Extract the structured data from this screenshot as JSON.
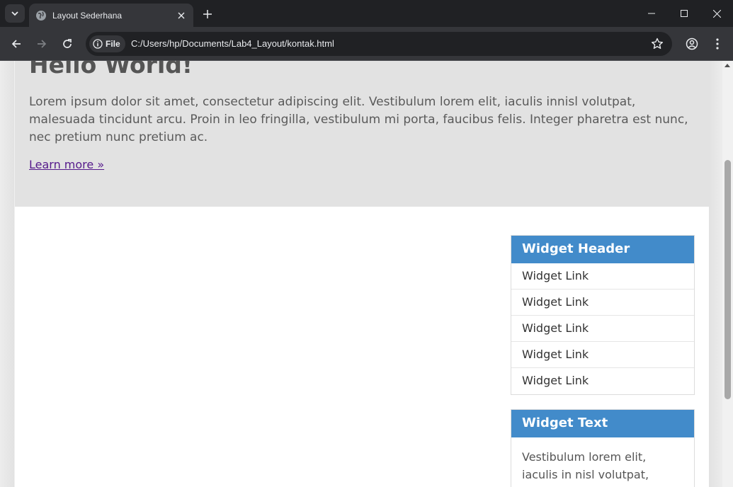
{
  "browser": {
    "tab_title": "Layout Sederhana",
    "chip_label": "File",
    "url": "C:/Users/hp/Documents/Lab4_Layout/kontak.html"
  },
  "hero": {
    "heading": "Hello World!",
    "paragraph": "Lorem ipsum dolor sit amet, consectetur adipiscing elit. Vestibulum lorem elit, iaculis innisl volutpat, malesuada tincidunt arcu. Proin in leo fringilla, vestibulum mi porta, faucibus felis. Integer pharetra est nunc, nec pretium nunc pretium ac.",
    "link": "Learn more »"
  },
  "sidebar": {
    "links_widget": {
      "header": "Widget Header",
      "links": [
        "Widget Link",
        "Widget Link",
        "Widget Link",
        "Widget Link",
        "Widget Link"
      ]
    },
    "text_widget": {
      "header": "Widget Text",
      "text": "Vestibulum lorem elit, iaculis in nisl volutpat, malesuada"
    }
  },
  "colors": {
    "widget_header_bg": "#428bca",
    "hero_bg": "#e2e2e2",
    "link": "#551a8b"
  }
}
